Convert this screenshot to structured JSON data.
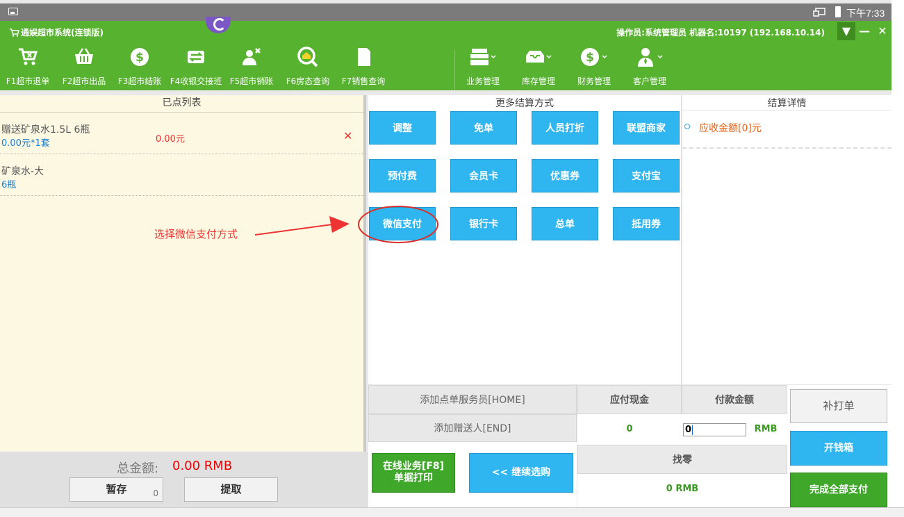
{
  "status_bar": {
    "time": "下午7:33"
  },
  "header": {
    "app_title": "通娱超市系统(连锁版)",
    "operator_info": "操作员:系统管理员  机器名:10197 (192.168.10.14)",
    "controls": {
      "dropdown": "▼",
      "minimize": "—",
      "close": "✕"
    }
  },
  "toolbar": [
    {
      "label": "F1超市退单",
      "icon": "cart-return-icon"
    },
    {
      "label": "F2超市出品",
      "icon": "basket-icon"
    },
    {
      "label": "F3超市结账",
      "icon": "dollar-coin-icon"
    },
    {
      "label": "F4收银交接班",
      "icon": "exchange-arrows-icon"
    },
    {
      "label": "F5超市销账",
      "icon": "users-remove-icon"
    },
    {
      "label": "F6房态查询",
      "icon": "house-search-icon"
    },
    {
      "label": "F7销售查询",
      "icon": "document-icon"
    }
  ],
  "menus": [
    {
      "label": "业务管理",
      "icon": "cash-register-icon"
    },
    {
      "label": "库存管理",
      "icon": "inbox-tray-icon"
    },
    {
      "label": "财务管理",
      "icon": "dollar-coin-icon"
    },
    {
      "label": "客户管理",
      "icon": "customer-icon"
    }
  ],
  "order_list": {
    "title": "已点列表",
    "items": [
      {
        "name": "赠送矿泉水1.5L 6瓶",
        "sub": "0.00元*1套",
        "price": "0.00元",
        "delete": "✕"
      },
      {
        "name": "矿泉水-大",
        "sub": "6瓶",
        "price": "",
        "delete": ""
      }
    ],
    "annotation": "选择微信支付方式"
  },
  "left_footer": {
    "total_label": "总金额:",
    "total_value": "0.00 RMB",
    "stash_label": "暂存",
    "stash_count": "0",
    "retrieve_label": "提取"
  },
  "payment_methods": {
    "title": "更多结算方式",
    "buttons": [
      "调整",
      "免单",
      "人员打折",
      "联盟商家",
      "预付费",
      "会员卡",
      "优惠券",
      "支付宝",
      "微信支付",
      "银行卡",
      "总单",
      "抵用券"
    ]
  },
  "settlement_details": {
    "title": "结算详情",
    "amount_due": "应收金额[0]元"
  },
  "bottom": {
    "add_waiter": "添加点单服务员[HOME]",
    "add_gifter": "添加赠送人[END]",
    "online_print_line1": "在线业务[F8]",
    "online_print_line2": "单据打印",
    "continue_shopping": "<< 继续选购",
    "cash_due_label": "应付现金",
    "cash_due_value": "0",
    "payment_amount_label": "付款金额",
    "payment_amount_value": "0",
    "payment_unit": "RMB",
    "change_label": "找零",
    "change_value": "0 RMB",
    "reprint": "补打单",
    "open_drawer": "开钱箱",
    "complete_payment": "完成全部支付"
  },
  "colors": {
    "header_green": "#57b22f",
    "pay_blue": "#2fb5f0",
    "action_green": "#3fa72a",
    "alert_red": "#e33333"
  }
}
